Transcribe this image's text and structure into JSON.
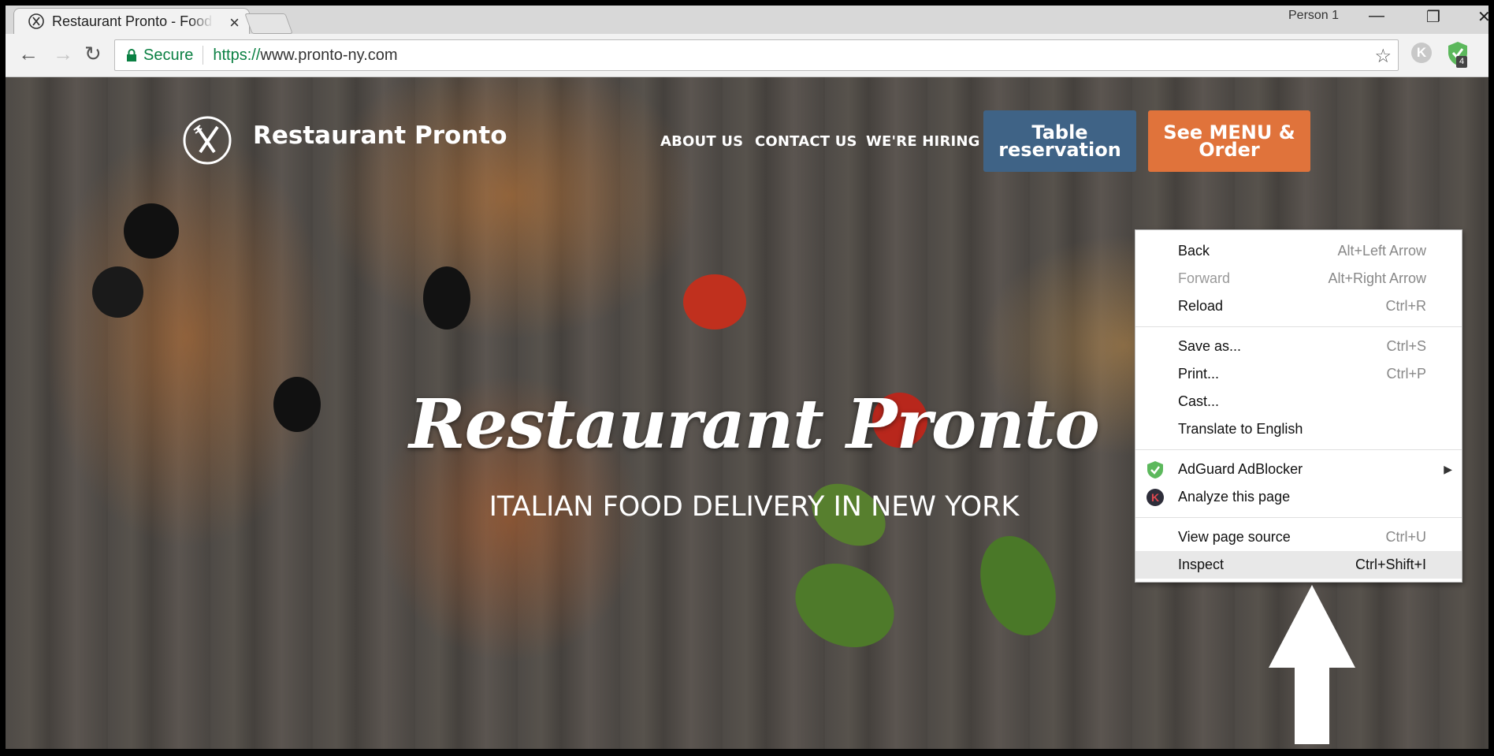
{
  "browser": {
    "tab_title": "Restaurant Pronto - Food",
    "tab_close": "×",
    "person": "Person 1",
    "controls": {
      "minimize": "—",
      "restore": "❐",
      "close": "✕"
    },
    "secure_label": "Secure",
    "url_scheme": "https://",
    "url_rest": "www.pronto-ny.com",
    "ext_k_label": "K",
    "ext_badge": "4"
  },
  "site": {
    "brand": "Restaurant Pronto",
    "nav": [
      "ABOUT US",
      "CONTACT US",
      "WE'RE HIRING"
    ],
    "btn_table": "Table reservation",
    "btn_menu": "See MENU & Order",
    "hero_title": "Restaurant Pronto",
    "hero_subtitle": "ITALIAN FOOD DELIVERY IN NEW YORK"
  },
  "context_menu": {
    "items": [
      {
        "label": "Back",
        "shortcut": "Alt+Left Arrow"
      },
      {
        "label": "Forward",
        "shortcut": "Alt+Right Arrow"
      },
      {
        "label": "Reload",
        "shortcut": "Ctrl+R"
      },
      {
        "label": "Save as...",
        "shortcut": "Ctrl+S"
      },
      {
        "label": "Print...",
        "shortcut": "Ctrl+P"
      },
      {
        "label": "Cast...",
        "shortcut": ""
      },
      {
        "label": "Translate to English",
        "shortcut": ""
      },
      {
        "label": "AdGuard AdBlocker",
        "shortcut": ""
      },
      {
        "label": "Analyze this page",
        "shortcut": ""
      },
      {
        "label": "View page source",
        "shortcut": "Ctrl+U"
      },
      {
        "label": "Inspect",
        "shortcut": "Ctrl+Shift+I"
      }
    ],
    "highlighted": "Inspect"
  },
  "colors": {
    "table_button": "#3f6386",
    "menu_button": "#e0733b",
    "secure_green": "#0b8043"
  }
}
